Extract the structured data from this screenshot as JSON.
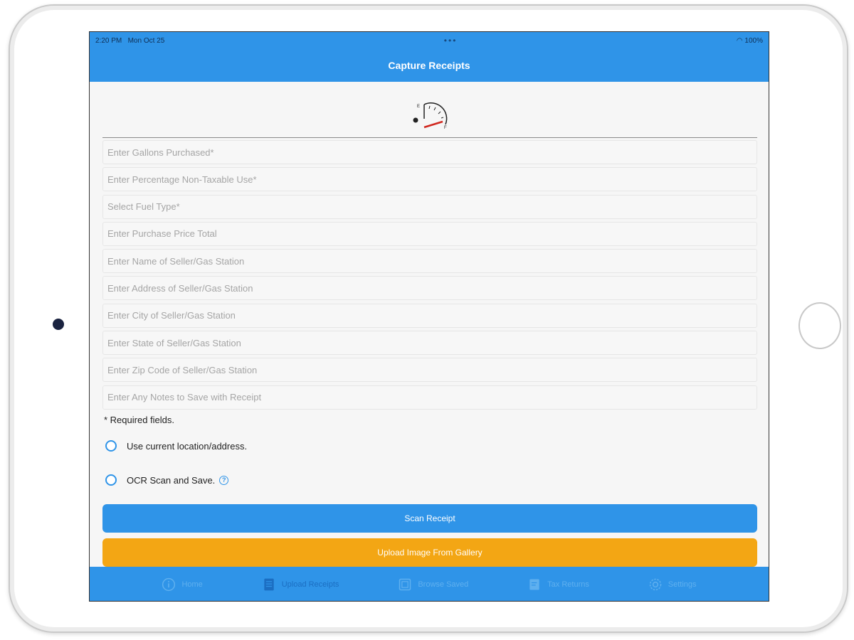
{
  "status_bar": {
    "time": "2:20 PM",
    "date": "Mon Oct 25",
    "dots": "•••",
    "battery": "100%"
  },
  "header": {
    "title": "Capture Receipts"
  },
  "form": {
    "fields": [
      {
        "placeholder": "Enter Gallons Purchased*",
        "value": ""
      },
      {
        "placeholder": "Enter Percentage Non-Taxable Use*",
        "value": ""
      },
      {
        "placeholder": "Select Fuel Type*",
        "value": ""
      },
      {
        "placeholder": "Enter Purchase Price Total",
        "value": ""
      },
      {
        "placeholder": "Enter Name of Seller/Gas Station",
        "value": ""
      },
      {
        "placeholder": "Enter Address of Seller/Gas Station",
        "value": ""
      },
      {
        "placeholder": "Enter City of Seller/Gas Station",
        "value": ""
      },
      {
        "placeholder": "Enter State of Seller/Gas Station",
        "value": ""
      },
      {
        "placeholder": "Enter Zip Code of Seller/Gas Station",
        "value": ""
      },
      {
        "placeholder": "Enter Any Notes to Save with Receipt",
        "value": ""
      }
    ],
    "required_note": "* Required fields.",
    "options": [
      {
        "label": "Use current location/address.",
        "checked": false
      },
      {
        "label": "OCR Scan and Save.",
        "checked": false
      }
    ]
  },
  "buttons": {
    "scan": "Scan Receipt",
    "upload": "Upload Image From Gallery"
  },
  "tabs": [
    {
      "label": "Home",
      "icon": "info-icon",
      "active": false
    },
    {
      "label": "Upload Receipts",
      "icon": "document-icon",
      "active": true
    },
    {
      "label": "Browse Saved",
      "icon": "gallery-icon",
      "active": false
    },
    {
      "label": "Tax Returns",
      "icon": "form-icon",
      "active": false
    },
    {
      "label": "Settings",
      "icon": "gear-icon",
      "active": false
    }
  ],
  "colors": {
    "primary": "#2f94e8",
    "upload_button": "#f3a614",
    "background": "#f6f6f6"
  }
}
